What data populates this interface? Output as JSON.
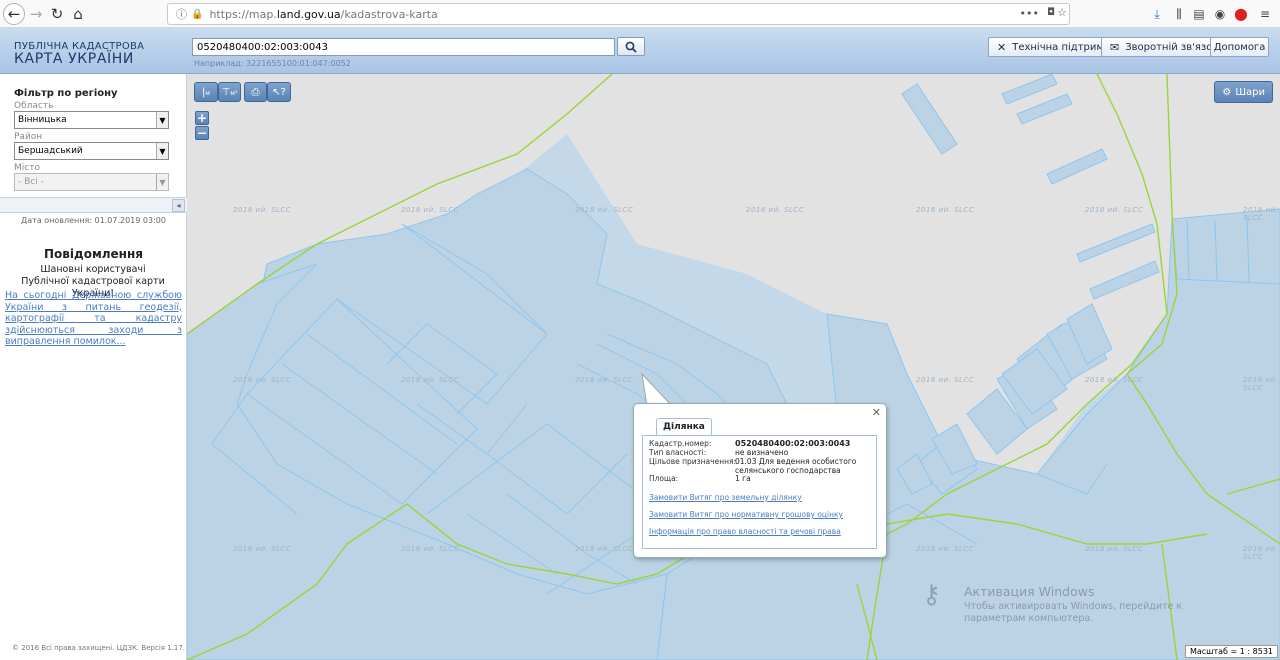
{
  "browser": {
    "url_prefix": "https://map.",
    "url_domain": "land.gov.ua",
    "url_path": "/kadastrova-karta",
    "menu_dots": "•••"
  },
  "header": {
    "logo_line1": "ПУБЛІЧНА КАДАСТРОВА",
    "logo_line2": "КАРТА УКРАЇНИ",
    "search_value": "0520480400:02:003:0043",
    "search_example": "Наприклад: 3221655100:01:047:0052",
    "buttons": {
      "support": "Технічна підтримка",
      "feedback": "Зворотній зв'язок",
      "help": "Допомога"
    }
  },
  "sidebar": {
    "filter_title": "Фільтр по регіону",
    "region_label": "Область",
    "region_value": "Вінницька",
    "district_label": "Район",
    "district_value": "Бершадський",
    "city_label": "Місто",
    "city_value": "- Всі -",
    "update_date": "Дата оновлення: 01.07.2019 03:00",
    "notice_title": "Повідомлення",
    "notice_greeting": "Шановні користувачі Публічної кадастрової карти України!",
    "notice_link": "На сьогодні Державною службою України з питань геодезії, картографії та кадастру здійснюються заходи з виправлення помилок...",
    "copyright": "© 2016 Всі права захищені. ЦДЗК. Версія 1.17."
  },
  "map": {
    "layers_label": "Шари",
    "zoom_in": "+",
    "zoom_out": "−",
    "watermark": "2018 ий. SLCC",
    "scale_label": "Масштаб = 1 : 8531"
  },
  "popup": {
    "tab": "Ділянка",
    "rows": [
      {
        "label": "Кадастр.номер:",
        "value": "0520480400:02:003:0043"
      },
      {
        "label": "Тип власності:",
        "value": "не визначено"
      },
      {
        "label": "Цільове призначення:",
        "value": "01.03 Для ведення особистого селянського господарства"
      },
      {
        "label": "Площа:",
        "value": "1 га"
      }
    ],
    "links": [
      "Замовити Витяг про земельну ділянку",
      "Замовити Витяг про нормативну грошову оцінку",
      "Інформація про право власності та речові права"
    ]
  },
  "windows_activation": {
    "title": "Активация Windows",
    "text": "Чтобы активировать Windows, перейдите к параметрам компьютера."
  }
}
